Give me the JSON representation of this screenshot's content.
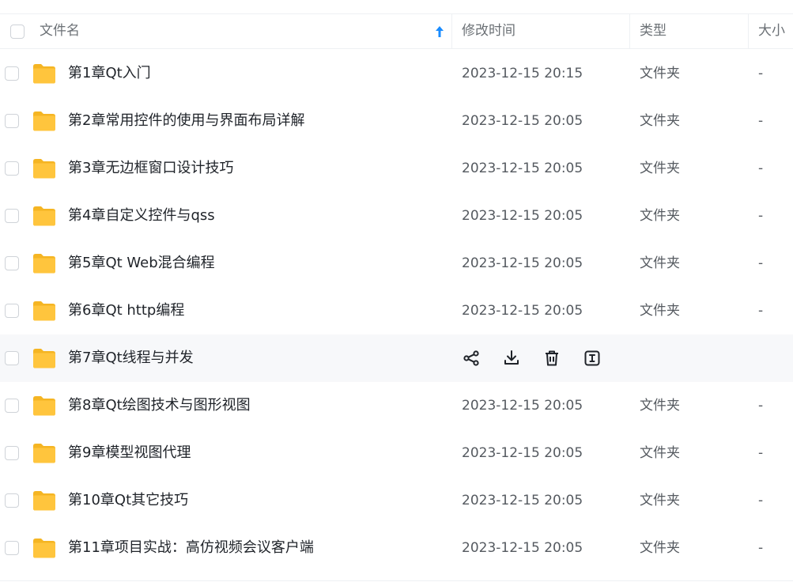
{
  "header": {
    "name": "文件名",
    "mtime": "修改时间",
    "type": "类型",
    "size": "大小"
  },
  "rows": [
    {
      "name": "第1章Qt入门",
      "mtime": "2023-12-15 20:15",
      "type": "文件夹",
      "size": "-"
    },
    {
      "name": "第2章常用控件的使用与界面布局详解",
      "mtime": "2023-12-15 20:05",
      "type": "文件夹",
      "size": "-"
    },
    {
      "name": "第3章无边框窗口设计技巧",
      "mtime": "2023-12-15 20:05",
      "type": "文件夹",
      "size": "-"
    },
    {
      "name": "第4章自定义控件与qss",
      "mtime": "2023-12-15 20:05",
      "type": "文件夹",
      "size": "-"
    },
    {
      "name": "第5章Qt Web混合编程",
      "mtime": "2023-12-15 20:05",
      "type": "文件夹",
      "size": "-"
    },
    {
      "name": "第6章Qt http编程",
      "mtime": "2023-12-15 20:05",
      "type": "文件夹",
      "size": "-"
    },
    {
      "name": "第7章Qt线程与并发",
      "actions": [
        "share-icon",
        "download-icon",
        "delete-icon",
        "rename-icon"
      ]
    },
    {
      "name": "第8章Qt绘图技术与图形视图",
      "mtime": "2023-12-15 20:05",
      "type": "文件夹",
      "size": "-"
    },
    {
      "name": "第9章模型视图代理",
      "mtime": "2023-12-15 20:05",
      "type": "文件夹",
      "size": "-"
    },
    {
      "name": "第10章Qt其它技巧",
      "mtime": "2023-12-15 20:05",
      "type": "文件夹",
      "size": "-"
    },
    {
      "name": "第11章项目实战：高仿视频会议客户端",
      "mtime": "2023-12-15 20:05",
      "type": "文件夹",
      "size": "-"
    }
  ],
  "colors": {
    "accent": "#1a8cff",
    "folder": "#ffc53d",
    "hover_row": "#f7f8fa"
  }
}
